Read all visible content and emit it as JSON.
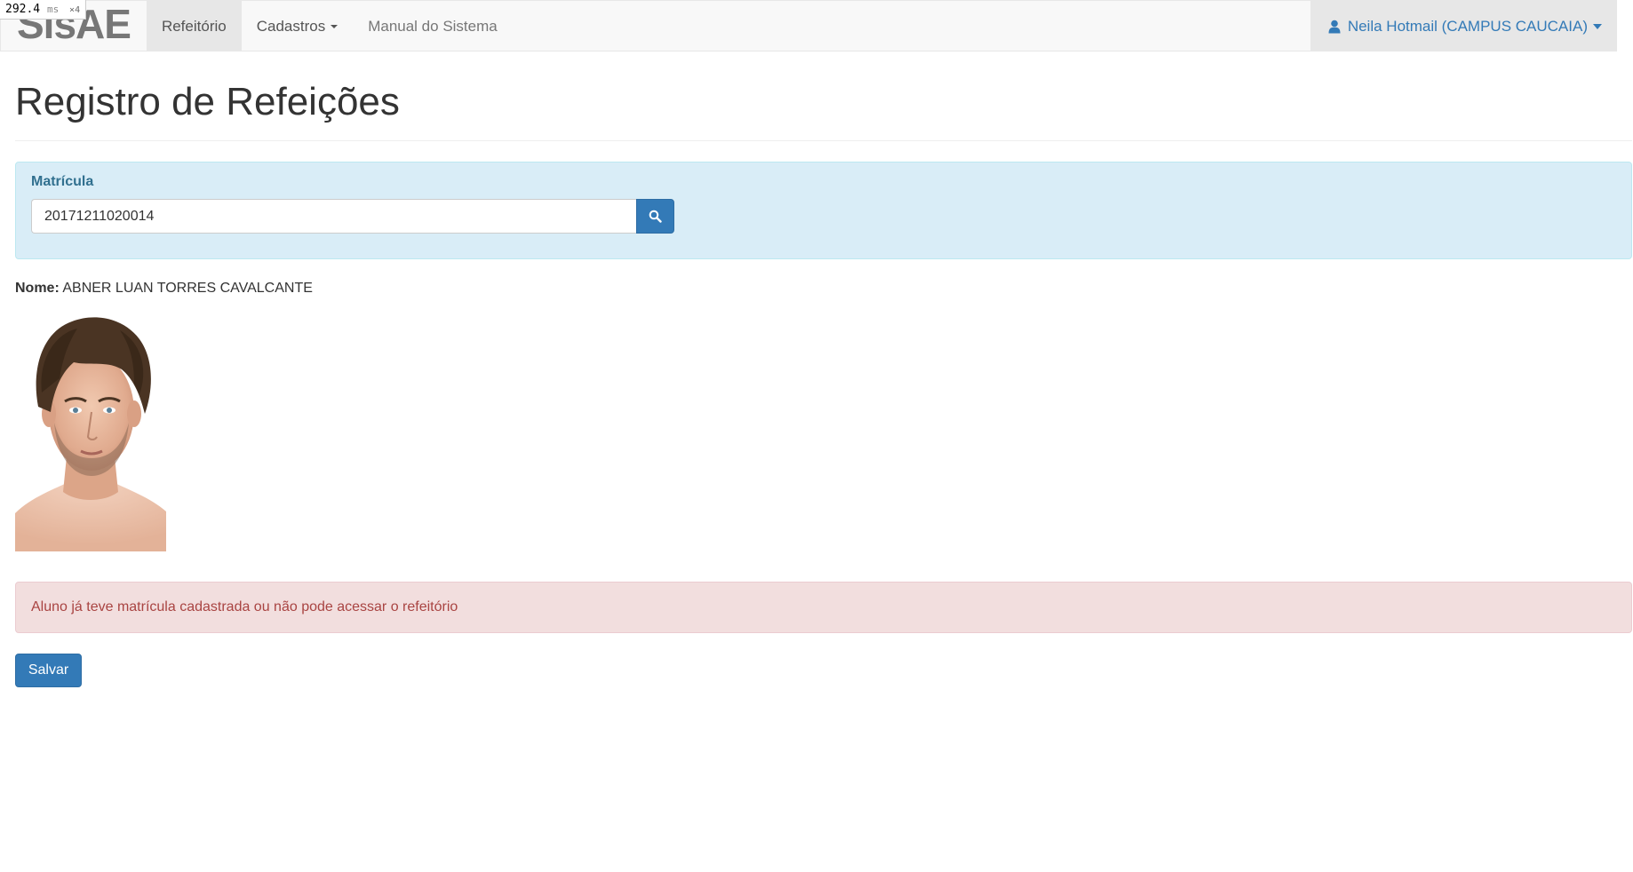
{
  "perf": {
    "value": "292.4",
    "unit": "ms",
    "multiplier": "×4"
  },
  "navbar": {
    "brand": "SisAE",
    "items": [
      {
        "label": "Refeitório",
        "active": true
      },
      {
        "label": "Cadastros",
        "dropdown": true
      },
      {
        "label": "Manual do Sistema"
      }
    ],
    "user": {
      "label": "Neila Hotmail (CAMPUS CAUCAIA)",
      "icon": "user-icon"
    }
  },
  "page": {
    "title": "Registro de Refeições"
  },
  "search": {
    "label": "Matrícula",
    "value": "20171211020014",
    "button_icon": "search-icon"
  },
  "student": {
    "name_label": "Nome:",
    "name": "ABNER LUAN TORRES CAVALCANTE"
  },
  "alert": {
    "message": "Aluno já teve matrícula cadastrada ou não pode acessar o refeitório"
  },
  "actions": {
    "save_label": "Salvar"
  },
  "colors": {
    "primary": "#337ab7",
    "info_bg": "#d9edf7",
    "info_text": "#31708f",
    "danger_bg": "#f2dede",
    "danger_text": "#a94442"
  }
}
